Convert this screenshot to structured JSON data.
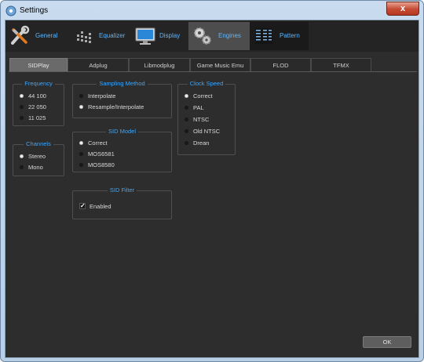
{
  "window": {
    "title": "Settings",
    "close_glyph": "x"
  },
  "categories": [
    {
      "label": "General",
      "icon": "tools-icon"
    },
    {
      "label": "Equalizer",
      "icon": "equalizer-icon"
    },
    {
      "label": "Display",
      "icon": "monitor-icon"
    },
    {
      "label": "Engines",
      "icon": "gears-icon",
      "active": true
    },
    {
      "label": "Pattern",
      "icon": "pattern-icon"
    }
  ],
  "tabs": [
    "SIDPlay",
    "Adplug",
    "Libmodplug",
    "Game Music Emu",
    "FLOD",
    "TFMX"
  ],
  "active_tab": "SIDPlay",
  "frequency": {
    "title": "Frequency",
    "options": [
      "44 100",
      "22 050",
      "11 025"
    ],
    "selected": "44 100"
  },
  "channels": {
    "title": "Channels",
    "options": [
      "Stereo",
      "Mono"
    ],
    "selected": "Stereo"
  },
  "sampling_method": {
    "title": "Sampling Method",
    "options": [
      "Interpolate",
      "Resample/Interpolate"
    ],
    "selected": "Resample/Interpolate"
  },
  "sid_model": {
    "title": "SID Model",
    "options": [
      "Correct",
      "MOS6581",
      "MOS8580"
    ],
    "selected": "Correct"
  },
  "sid_filter": {
    "title": "SID Filter",
    "enabled_label": "Enabled",
    "checked": true,
    "check_glyph": "✓"
  },
  "clock_speed": {
    "title": "Clock Speed",
    "options": [
      "Correct",
      "PAL",
      "NTSC",
      "Old NTSC",
      "Drean"
    ],
    "selected": "Correct"
  },
  "ok_label": "OK",
  "colors": {
    "accent_blue": "#3aa7ff",
    "panel_bg": "#2d2d2d",
    "title_bar": "#c9dbee",
    "close_red": "#c54a33"
  }
}
